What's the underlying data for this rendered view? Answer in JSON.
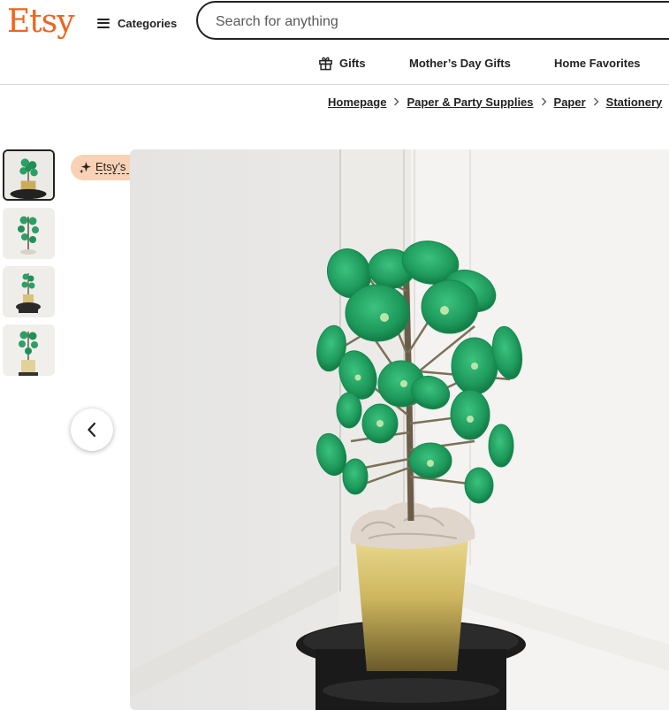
{
  "header": {
    "logo": "Etsy",
    "categories_label": "Categories",
    "search": {
      "placeholder": "Search for anything",
      "value": ""
    }
  },
  "nav": {
    "items": [
      {
        "label": "Gifts",
        "icon": "gift-icon"
      },
      {
        "label": "Mother’s Day Gifts"
      },
      {
        "label": "Home Favorites"
      }
    ]
  },
  "breadcrumb": [
    "Homepage",
    "Paper & Party Supplies",
    "Paper",
    "Stationery"
  ],
  "listing": {
    "badge": {
      "label": "Etsy’s Pick",
      "icon": "sparkle-icon"
    },
    "thumbnail_count": 4,
    "active_thumbnail": 1,
    "prev_icon": "chevron-left-icon"
  },
  "colors": {
    "brand": "#F1641E",
    "badge_bg": "#F9D2B5",
    "text": "#222222"
  }
}
